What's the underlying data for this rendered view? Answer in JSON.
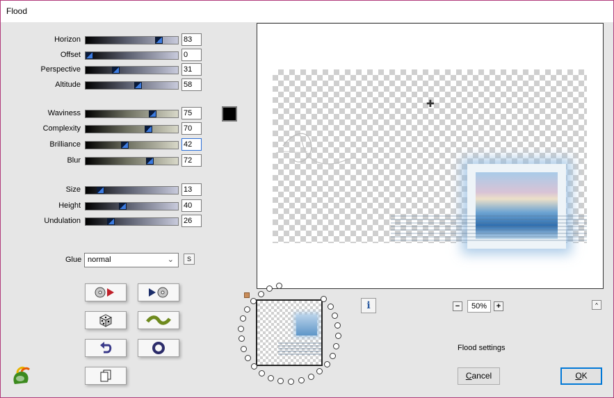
{
  "window": {
    "title": "Flood",
    "border_color": "#b03a7a"
  },
  "groups": [
    [
      {
        "label": "Horizon",
        "value": "83",
        "level_percent": 83,
        "track": "blue"
      },
      {
        "label": "Offset",
        "value": "0",
        "level_percent": 0,
        "track": "blue"
      },
      {
        "label": "Perspective",
        "value": "31",
        "level_percent": 31,
        "track": "blue"
      },
      {
        "label": "Altitude",
        "value": "58",
        "level_percent": 58,
        "track": "blue"
      }
    ],
    [
      {
        "label": "Waviness",
        "value": "75",
        "level_percent": 75,
        "track": "olive"
      },
      {
        "label": "Complexity",
        "value": "70",
        "level_percent": 70,
        "track": "olive"
      },
      {
        "label": "Brilliance",
        "value": "42",
        "level_percent": 42,
        "track": "olive",
        "focused": true
      },
      {
        "label": "Blur",
        "value": "72",
        "level_percent": 72,
        "track": "olive"
      }
    ],
    [
      {
        "label": "Size",
        "value": "13",
        "level_percent": 13,
        "track": "blue"
      },
      {
        "label": "Height",
        "value": "40",
        "level_percent": 40,
        "track": "blue"
      },
      {
        "label": "Undulation",
        "value": "26",
        "level_percent": 26,
        "track": "blue"
      }
    ]
  ],
  "color_swatch": {
    "color": "#000000"
  },
  "glue": {
    "label": "Glue",
    "selected": "normal",
    "s_button": "S"
  },
  "tool_buttons": [
    {
      "name": "load-preset-button",
      "icon": "disc-arrow-icon"
    },
    {
      "name": "save-preset-button",
      "icon": "arrow-disc-icon"
    },
    {
      "name": "random-button",
      "icon": "dice-icon"
    },
    {
      "name": "wave-button",
      "icon": "wave-icon"
    },
    {
      "name": "undo-button",
      "icon": "undo-arrow-icon"
    },
    {
      "name": "reset-button",
      "icon": "ring-icon"
    },
    {
      "name": "copy-button",
      "icon": "copy-pages-icon"
    }
  ],
  "preview": {
    "zoom": "50%",
    "info_label": "i",
    "collapse_label": "^"
  },
  "status": {
    "text": "Flood settings"
  },
  "buttons": {
    "cancel_first": "C",
    "cancel_rest": "ancel",
    "ok_first": "O",
    "ok_rest": "K"
  }
}
